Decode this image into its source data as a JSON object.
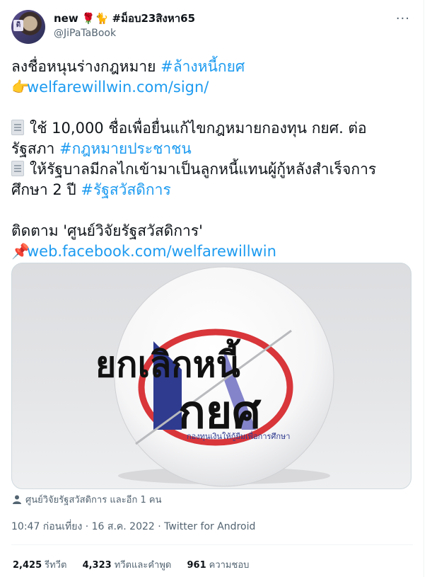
{
  "author": {
    "display_name": "new 🌹🐈 #ม็อบ23สิงหา65",
    "handle": "@JiPaTaBook",
    "avatar_badge": "ดิ"
  },
  "tweet": {
    "line1_text": "ลงชื่อหนุนร่างกฎหมาย ",
    "line1_hashtag": "#ล้างหนี้กยศ",
    "line2_link": "welfarewillwin.com/sign/",
    "line3_text": "ใช้ 10,000 ชื่อเพื่อยื่นแก้ไขกฎหมายกองทุน กยศ. ต่อ",
    "line4_text": "รัฐสภา ",
    "line4_hashtag": "#กฎหมายประชาชน",
    "line5_text": "ให้รัฐบาลมีกลไกเข้ามาเป็นลูกหนี้แทนผู้กู้หลังสำเร็จการ",
    "line6_text": "ศึกษา 2 ปี ",
    "line6_hashtag": "#รัฐสวัสดิการ",
    "line7_text": "ติดตาม 'ศูนย์วิจัยรัฐสวัสดิการ'",
    "line8_link": "web.facebook.com/welfarewillwin"
  },
  "media": {
    "headline_top": "ยกเลิกหนี้",
    "headline_bottom": "กยศ",
    "badge_text": "กองทุนเงินให้กู้ยืมเพื่อการศึกษา"
  },
  "tagged": "ศูนย์วิจัยรัฐสวัสดิการ และอีก 1 คน",
  "meta": "10:47 ก่อนเที่ยง · 16 ส.ค. 2022 · Twitter for Android",
  "stats": {
    "retweets_count": "2,425",
    "retweets_label": "รีทวีต",
    "quotes_count": "4,323",
    "quotes_label": "ทวีตและคำพูด",
    "likes_count": "961",
    "likes_label": "ความชอบ"
  },
  "icons": {
    "pointing": "👉",
    "pin": "📌",
    "more": "···"
  },
  "colors": {
    "link": "#1d9bf0",
    "text": "#0f1419",
    "muted": "#536471"
  }
}
